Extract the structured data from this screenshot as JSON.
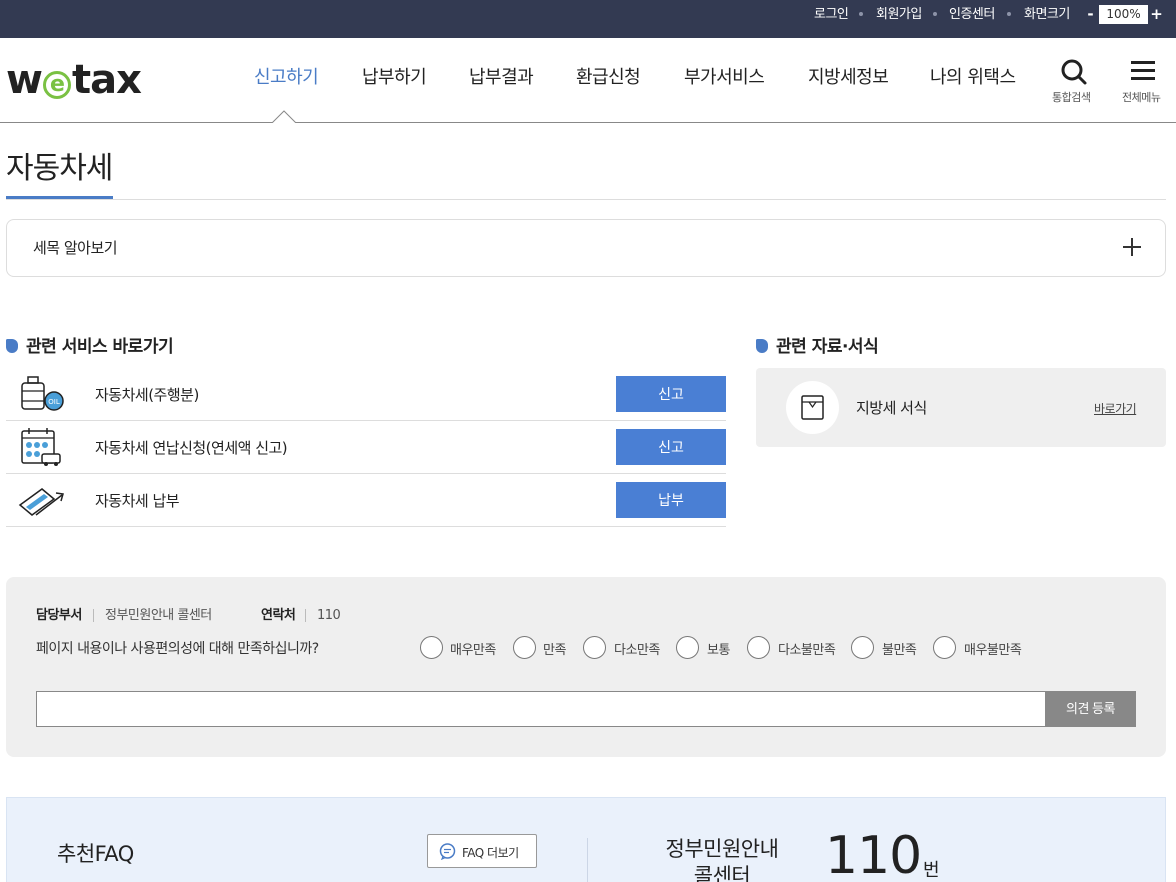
{
  "topbar": {
    "login": "로그인",
    "signup": "회원가입",
    "cert_center": "인증센터",
    "screen_size": "화면크기",
    "zoom_minus": "-",
    "zoom_value": "100%",
    "zoom_plus": "+"
  },
  "header": {
    "logo_w": "w",
    "logo_e": "e",
    "logo_tax": "tax",
    "nav": [
      "신고하기",
      "납부하기",
      "납부결과",
      "환급신청",
      "부가서비스",
      "지방세정보",
      "나의 위택스"
    ],
    "active_nav": "신고하기",
    "search_label": "통합검색",
    "menu_label": "전체메뉴"
  },
  "page": {
    "title": "자동차세"
  },
  "accordion": {
    "label": "세목 알아보기"
  },
  "related_services": {
    "heading": "관련 서비스 바로가기",
    "items": [
      {
        "label": "자동차세(주행분)",
        "button": "신고",
        "icon": "fuel-oil-icon"
      },
      {
        "label": "자동차세 연납신청(연세액 신고)",
        "button": "신고",
        "icon": "calendar-car-icon"
      },
      {
        "label": "자동차세 납부",
        "button": "납부",
        "icon": "card-payment-icon"
      }
    ]
  },
  "related_forms": {
    "heading": "관련 자료·서식",
    "label": "지방세 서식",
    "link": "바로가기",
    "icon": "document-form-icon"
  },
  "survey": {
    "dept_label": "담당부서",
    "dept_value": "정부민원안내 콜센터",
    "contact_label": "연락처",
    "contact_value": "110",
    "question": "페이지 내용이나 사용편의성에 대해 만족하십니까?",
    "options": [
      "매우만족",
      "만족",
      "다소만족",
      "보통",
      "다소불만족",
      "불만족",
      "매우불만족"
    ],
    "input_value": "",
    "submit": "의견 등록"
  },
  "faq": {
    "title": "추천FAQ",
    "more": "FAQ 더보기",
    "call_center": "정부민원안내 콜센터",
    "number": "110",
    "unit": "번"
  },
  "colors": {
    "topbar": "#333a52",
    "accent": "#4a7cc6",
    "button": "#4a7fd4",
    "logo_e": "#7ac143"
  }
}
